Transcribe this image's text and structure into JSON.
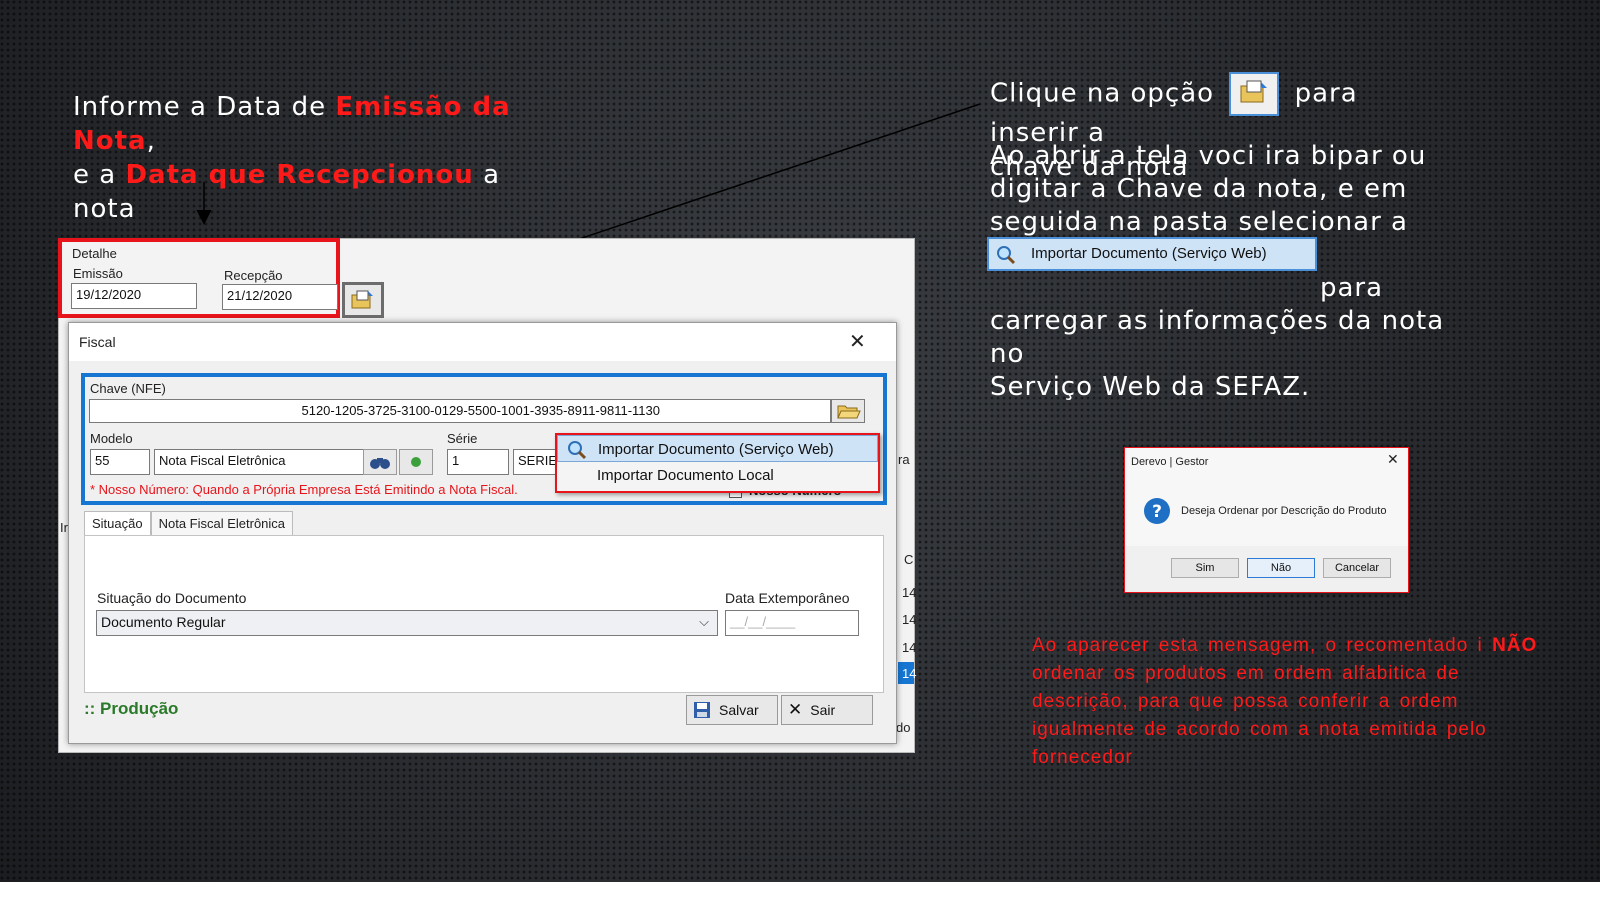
{
  "colors": {
    "accent_red": "#e8141b",
    "accent_blue": "#1676d2",
    "text_white": "#ffffff",
    "producao_green": "#2a7a2a"
  },
  "instructions": {
    "left": {
      "p1": "Informe a Data de ",
      "r1": "Emissão da Nota",
      "p2": ",",
      "p3": "e a ",
      "r2": "Data que Recepcionou",
      "p4": " a nota"
    },
    "right_top": {
      "p1": "Clique na opção",
      "p2": "para inserir a",
      "p3": "chave da nota"
    },
    "right_body": {
      "p1": "Ao abrir a tela voci ira bipar ou digitar a Chave da nota, e em seguida na pasta selecionar a opção",
      "p2": "para carregar as informações da nota no",
      "p3": "Serviço Web da SEFAZ."
    },
    "ribbon_item": "Importar Documento (Serviço Web)",
    "warning": {
      "p1": "Ao aparecer esta mensagem, o recomentado i",
      "bold": "NÃO",
      "p2": "ordenar os produtos em ordem alfabitica de descrição, para que possa conferir a ordem igualmente de acordo com a nota emitida pelo fornecedor"
    }
  },
  "app": {
    "detalhe_label": "Detalhe",
    "emissao_label": "Emissão",
    "emissao_value": "19/12/2020",
    "recepcao_label": "Recepção",
    "recepcao_value": "21/12/2020",
    "fiscal": {
      "title": "Fiscal",
      "close": "✕",
      "chave_label": "Chave (NFE)",
      "chave_value": "5120-1205-3725-3100-0129-5500-1001-3935-8911-9811-1130",
      "modelo_label": "Modelo",
      "modelo_code": "55",
      "modelo_desc": "Nota Fiscal Eletrônica",
      "serie_label": "Série",
      "serie_value": "1",
      "serie_desc": "SERIE",
      "nosso_numero_note": "* Nosso Número: Quando a Própria Empresa Está Emitindo a Nota Fiscal.",
      "nosso_numero_check": "Nosso Número",
      "tabs": [
        "Situação",
        "Nota Fiscal Eletrônica"
      ],
      "situacao_label": "Situação do Documento",
      "situacao_value": "Documento Regular",
      "extemp_label": "Data Extemporâneo",
      "extemp_placeholder": "__/__/____",
      "producao": ":: Produção",
      "salvar": "Salvar",
      "sair": "Sair"
    },
    "popup_items": [
      "Importar Documento (Serviço Web)",
      "Importar Documento Local"
    ],
    "side_fragments": {
      "left_edge": "Ir",
      "right_c": "C",
      "right_rows": [
        "14",
        "14",
        "14",
        "14"
      ],
      "right_do": "do",
      "right_ra": "ra"
    }
  },
  "dialog": {
    "title": "Derevo | Gestor",
    "close": "✕",
    "message": "Deseja Ordenar por Descrição do Produto",
    "buttons": [
      "Sim",
      "Não",
      "Cancelar"
    ]
  }
}
